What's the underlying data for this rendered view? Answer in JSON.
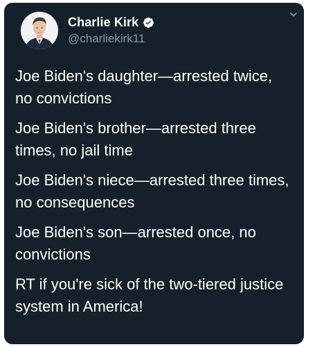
{
  "tweet": {
    "author": {
      "display_name": "Charlie Kirk",
      "handle": "@charliekirk11",
      "verified": true,
      "avatar_icon": "profile-photo"
    },
    "paragraphs": [
      "Joe Biden's daughter—arrested twice, no convictions",
      "Joe Biden's brother—arrested three times, no jail time",
      "Joe Biden's niece—arrested three times, no consequences",
      "Joe Biden's son—arrested once, no convictions",
      "RT if you're sick of the two-tiered justice system in America!"
    ],
    "menu_icon": "chevron-down-icon"
  },
  "theme": {
    "background": "#15202b",
    "text": "#ffffff",
    "secondary_text": "#8899a6",
    "verified_blue": "#1d9bf0"
  }
}
